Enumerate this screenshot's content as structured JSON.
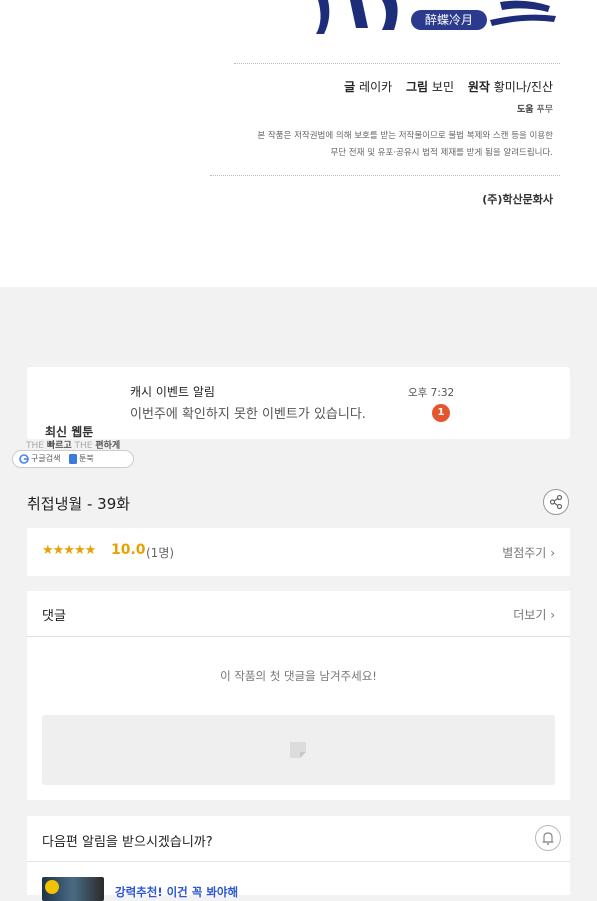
{
  "header_art": {
    "subtitle_badge": "醉蝶冷月"
  },
  "credits": {
    "writer_label": "글",
    "writer": "레이카",
    "artist_label": "그림",
    "artist": "보민",
    "original_label": "원작",
    "original": "황미나/진산",
    "assist_label": "도움",
    "assist": "푸무"
  },
  "notice": {
    "line1": "본 작품은 저작권법에 의해 보호를 받는 저작물이므로 불법 복제와 스캔 등을 이용한",
    "line2": "무단 전재 및 유포·공유시 법적 제재를 받게 됨을 알려드립니다."
  },
  "publisher": "(주)학산문화사",
  "notification": {
    "title": "캐시 이벤트 알림",
    "body": "이번주에 확인하지 못한 이벤트가 있습니다.",
    "time": "오후 7:32",
    "badge_count": "1"
  },
  "banner": {
    "title": "최신 웹툰",
    "tag_the1": "THE",
    "tag_word1": "빠르고",
    "tag_the2": "THE",
    "tag_word2": "편하게",
    "pill_left": "구글검색",
    "pill_right": "툰북"
  },
  "episode": {
    "title": "취접냉월 - 39화"
  },
  "rating": {
    "stars": "★★★★★",
    "score": "10.0",
    "count": "(1명)",
    "rate_button": "별점주기"
  },
  "comments": {
    "title": "댓글",
    "more": "더보기",
    "empty": "이 작품의 첫 댓글을 남겨주세요!"
  },
  "next_episode": {
    "question": "다음편 알림을 받으시겠습니까?",
    "promo": "강력추천! 이건 꼭 봐야해"
  },
  "colors": {
    "accent_gold": "#e8a200",
    "badge_red": "#e4572e",
    "link_blue": "#2a55d4",
    "logo_navy": "#1d2d7a"
  }
}
